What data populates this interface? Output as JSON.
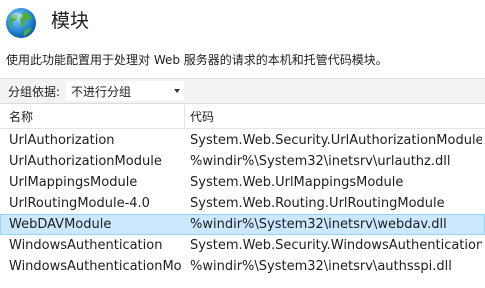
{
  "header": {
    "title": "模块",
    "icon": "globe-icon"
  },
  "description": "使用此功能配置用于处理对 Web 服务器的请求的本机和托管代码模块。",
  "group_by": {
    "label": "分组依据:",
    "selected": "不进行分组"
  },
  "columns": {
    "name": "名称",
    "code": "代码"
  },
  "colors": {
    "selected_row_bg": "#cce8ff",
    "selected_row_border": "#99d1ff",
    "group_bar_bg": "#f3f3f3"
  },
  "rows": [
    {
      "name": "UrlAuthorization",
      "code": "System.Web.Security.UrlAuthorizationModule"
    },
    {
      "name": "UrlAuthorizationModule",
      "code": "%windir%\\System32\\inetsrv\\urlauthz.dll"
    },
    {
      "name": "UrlMappingsModule",
      "code": "System.Web.UrlMappingsModule"
    },
    {
      "name": "UrlRoutingModule-4.0",
      "code": "System.Web.Routing.UrlRoutingModule"
    },
    {
      "name": "WebDAVModule",
      "code": "%windir%\\System32\\inetsrv\\webdav.dll",
      "selected": true
    },
    {
      "name": "WindowsAuthentication",
      "code": "System.Web.Security.WindowsAuthenticationMo..."
    },
    {
      "name": "WindowsAuthenticationMo...",
      "code": "%windir%\\System32\\inetsrv\\authsspi.dll"
    }
  ]
}
